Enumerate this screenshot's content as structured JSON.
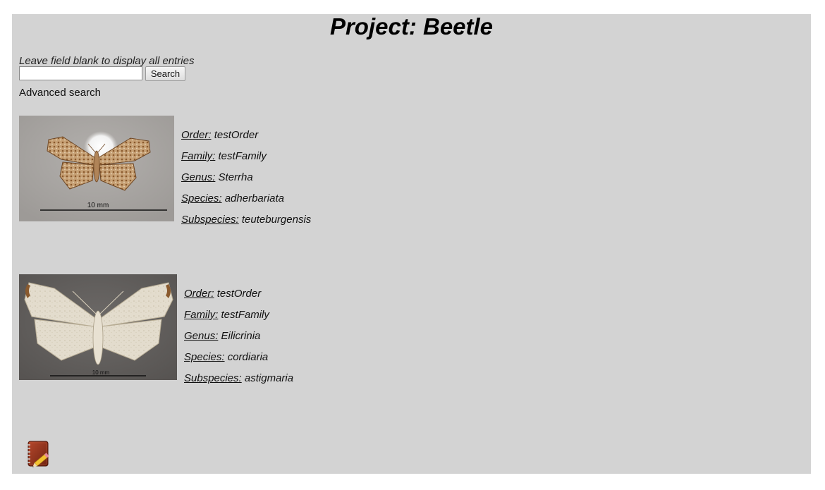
{
  "page": {
    "title": "Project: Beetle"
  },
  "search": {
    "hint": "Leave field blank to display all entries",
    "value": "",
    "placeholder": "",
    "button_label": "Search",
    "advanced_label": "Advanced search"
  },
  "entries": [
    {
      "scale_label": "10 mm",
      "fields": [
        {
          "label": "Order:",
          "value": "testOrder"
        },
        {
          "label": "Family:",
          "value": "testFamily"
        },
        {
          "label": "Genus:",
          "value": "Sterrha"
        },
        {
          "label": "Species:",
          "value": "adherbariata"
        },
        {
          "label": "Subspecies:",
          "value": "teuteburgensis"
        }
      ]
    },
    {
      "scale_label": "10 mm",
      "fields": [
        {
          "label": "Order:",
          "value": "testOrder"
        },
        {
          "label": "Family:",
          "value": "testFamily"
        },
        {
          "label": "Genus:",
          "value": "Eilicrinia"
        },
        {
          "label": "Species:",
          "value": "cordiaria"
        },
        {
          "label": "Subspecies:",
          "value": "astigmaria"
        }
      ]
    }
  ],
  "footer": {
    "icon": "notebook-pencil-icon"
  }
}
